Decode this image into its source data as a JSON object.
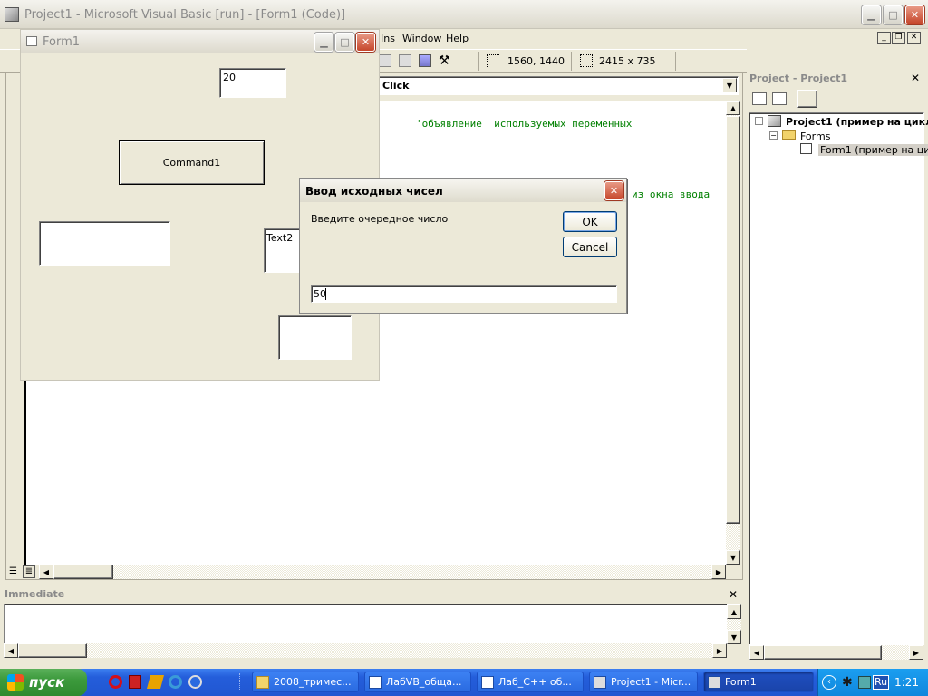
{
  "vb": {
    "title": "Project1 - Microsoft Visual Basic [run] - [Form1 (Code)]",
    "menu_partial": [
      "Ins",
      "Window",
      "Help"
    ],
    "position_readout": "1560, 1440",
    "size_readout": "2415 x 735",
    "procedure_combo": "Click",
    "code_lines": [
      "'объявление  используемых переменных",
      "из окна ввода"
    ]
  },
  "project": {
    "title": "Project - Project1",
    "root": "Project1 (пример на цикл",
    "forms_folder": "Forms",
    "form_item": "Form1 (пример на цикл"
  },
  "immediate": {
    "title": "Immediate"
  },
  "form1": {
    "title": "Form1",
    "text_top": "20",
    "command_label": "Command1",
    "text2": "Text2"
  },
  "dialog": {
    "title": "Ввод исходных чисел",
    "prompt": "Введите очередное число",
    "ok": "OK",
    "cancel": "Cancel",
    "input_value": "50"
  },
  "taskbar": {
    "start": "пуск",
    "tasks": [
      {
        "label": "2008_тримес..."
      },
      {
        "label": "ЛабVB_обща..."
      },
      {
        "label": "Лаб_С++ об..."
      },
      {
        "label": "Project1 - Micr..."
      },
      {
        "label": "Form1"
      }
    ],
    "lang": "Ru",
    "clock": "1:21"
  },
  "colors": {
    "title_active": "#0054e3",
    "code_green": "#008000",
    "taskbar": "#245edb",
    "start": "#3c9a3c"
  }
}
